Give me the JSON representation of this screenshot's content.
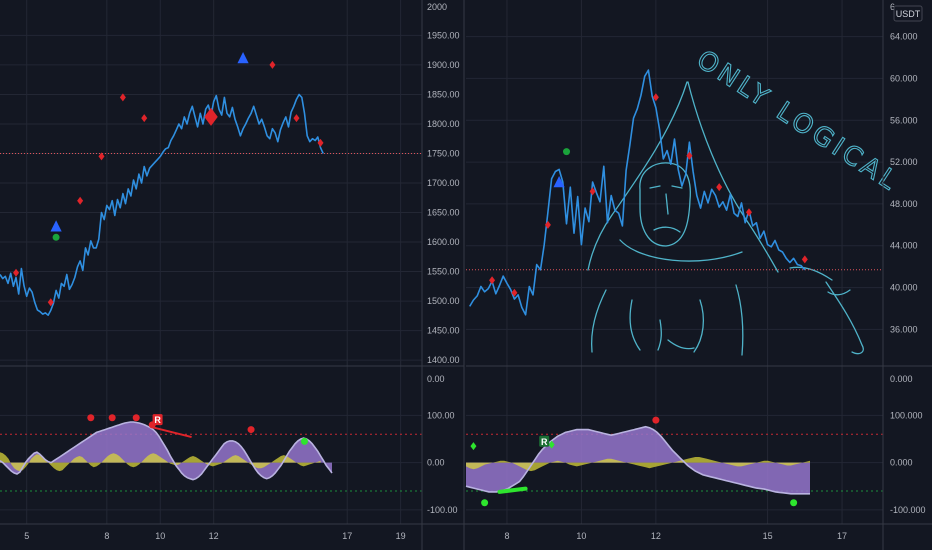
{
  "colors": {
    "background": "#131722",
    "grid": "#232734",
    "divider": "#363a45",
    "price_line": "#2f8fe0",
    "buy_triangle": "#2962ff",
    "sell_diamond": "#e0242a",
    "buy_dot": "#1aa33b",
    "osc_fill": "#9575cd",
    "osc_line": "#b9b3e0",
    "yellow_fill": "#d8d33a",
    "upper_band": "#c62833",
    "lower_band": "#1b8e3c",
    "green_signal": "#2ee52e",
    "doodle": "#4fb3c9",
    "current_price": "#e0535a"
  },
  "left_chart": {
    "chart_data": {
      "type": "line",
      "y_ticks": [
        "1950.00",
        "1900.00",
        "1850.00",
        "1800.00",
        "1750.00",
        "1700.00",
        "1650.00",
        "1600.00",
        "1550.00",
        "1500.00",
        "1450.00",
        "1400.00"
      ],
      "y_tick_values": [
        1950,
        1900,
        1850,
        1800,
        1750,
        1700,
        1650,
        1600,
        1550,
        1500,
        1450,
        1400
      ],
      "y_top_cut_label": "2000",
      "ylim": [
        1390,
        2010
      ],
      "x_ticks": [
        {
          "label": "5",
          "x": 5
        },
        {
          "label": "8",
          "x": 8
        },
        {
          "label": "10",
          "x": 10
        },
        {
          "label": "12",
          "x": 12
        },
        {
          "label": "17",
          "x": 17
        },
        {
          "label": "19",
          "x": 19
        }
      ],
      "xlim": [
        4.0,
        19.8
      ],
      "current_price": 1750,
      "x": [
        4.0,
        4.1,
        4.2,
        4.3,
        4.4,
        4.5,
        4.6,
        4.7,
        4.8,
        4.9,
        5.0,
        5.1,
        5.2,
        5.3,
        5.4,
        5.5,
        5.6,
        5.7,
        5.8,
        5.9,
        6.0,
        6.1,
        6.2,
        6.3,
        6.4,
        6.5,
        6.6,
        6.7,
        6.8,
        6.9,
        7.0,
        7.1,
        7.2,
        7.3,
        7.4,
        7.5,
        7.6,
        7.7,
        7.8,
        7.9,
        8.0,
        8.1,
        8.2,
        8.3,
        8.4,
        8.5,
        8.6,
        8.7,
        8.8,
        8.9,
        9.0,
        9.1,
        9.2,
        9.3,
        9.4,
        9.5,
        9.6,
        9.7,
        9.8,
        9.9,
        10.0,
        10.1,
        10.2,
        10.3,
        10.4,
        10.5,
        10.6,
        10.7,
        10.8,
        10.9,
        11.0,
        11.1,
        11.2,
        11.3,
        11.4,
        11.5,
        11.6,
        11.7,
        11.8,
        11.9,
        12.0,
        12.1,
        12.2,
        12.3,
        12.4,
        12.5,
        12.6,
        12.7,
        12.8,
        12.9,
        13.0,
        13.1,
        13.2,
        13.3,
        13.4,
        13.5,
        13.6,
        13.7,
        13.8,
        13.9,
        14.0,
        14.1,
        14.2,
        14.3,
        14.4,
        14.5,
        14.6,
        14.7,
        14.8,
        14.9,
        15.0,
        15.1,
        15.2,
        15.3,
        15.4,
        15.5,
        15.6,
        15.7,
        15.8,
        15.9,
        16.0,
        16.1
      ],
      "values": [
        1545,
        1538,
        1542,
        1530,
        1547,
        1525,
        1540,
        1512,
        1555,
        1526,
        1508,
        1522,
        1515,
        1498,
        1485,
        1482,
        1478,
        1480,
        1476,
        1484,
        1496,
        1518,
        1505,
        1530,
        1525,
        1545,
        1520,
        1528,
        1540,
        1558,
        1568,
        1552,
        1590,
        1578,
        1602,
        1590,
        1590,
        1605,
        1650,
        1638,
        1662,
        1655,
        1670,
        1645,
        1672,
        1658,
        1682,
        1665,
        1690,
        1678,
        1705,
        1690,
        1715,
        1700,
        1728,
        1712,
        1725,
        1730,
        1735,
        1740,
        1745,
        1752,
        1758,
        1760,
        1772,
        1780,
        1790,
        1800,
        1792,
        1812,
        1800,
        1818,
        1830,
        1812,
        1795,
        1818,
        1800,
        1825,
        1832,
        1815,
        1838,
        1848,
        1825,
        1815,
        1845,
        1818,
        1812,
        1828,
        1808,
        1795,
        1780,
        1792,
        1800,
        1810,
        1818,
        1830,
        1815,
        1800,
        1808,
        1795,
        1780,
        1775,
        1792,
        1785,
        1770,
        1790,
        1802,
        1812,
        1795,
        1820,
        1830,
        1842,
        1850,
        1845,
        1818,
        1780,
        1770,
        1775,
        1772,
        1778,
        1760,
        1750
      ],
      "markers": {
        "buy_triangles": [
          {
            "x": 6.1,
            "y": 1625
          },
          {
            "x": 13.1,
            "y": 1910
          }
        ],
        "buy_dots": [
          {
            "x": 6.1,
            "y": 1608
          }
        ],
        "sell_diamonds": [
          {
            "x": 4.6,
            "y": 1548
          },
          {
            "x": 5.9,
            "y": 1498
          },
          {
            "x": 7.0,
            "y": 1670
          },
          {
            "x": 7.8,
            "y": 1745
          },
          {
            "x": 8.6,
            "y": 1845
          },
          {
            "x": 9.4,
            "y": 1810
          },
          {
            "x": 11.9,
            "y": 1812
          },
          {
            "x": 14.2,
            "y": 1900
          },
          {
            "x": 15.1,
            "y": 1810
          },
          {
            "x": 16.0,
            "y": 1768
          }
        ],
        "big_diamonds": [
          {
            "x": 11.9,
            "y": 1812
          }
        ]
      }
    },
    "osc_data": {
      "type": "area",
      "y_ticks": [
        "100.00",
        "0.00",
        "-100.00"
      ],
      "y_tick_values": [
        100,
        0,
        -100
      ],
      "top_label": "0.00",
      "ylim": [
        -130,
        175
      ],
      "bands": [
        60,
        -60
      ],
      "values": [
        4,
        0,
        -6,
        -12,
        -18,
        -22,
        -24,
        -20,
        -10,
        0,
        8,
        14,
        20,
        22,
        18,
        12,
        6,
        2,
        0,
        4,
        8,
        12,
        16,
        20,
        24,
        28,
        32,
        36,
        40,
        44,
        48,
        52,
        56,
        60,
        64,
        66,
        68,
        70,
        72,
        74,
        76,
        78,
        80,
        82,
        84,
        85,
        86,
        86,
        85,
        84,
        82,
        80,
        77,
        74,
        70,
        64,
        56,
        46,
        36,
        26,
        14,
        4,
        -6,
        -14,
        -22,
        -28,
        -32,
        -34,
        -36,
        -34,
        -30,
        -24,
        -16,
        -8,
        0,
        8,
        16,
        24,
        32,
        40,
        44,
        46,
        46,
        44,
        40,
        34,
        26,
        16,
        6,
        -4,
        -14,
        -22,
        -28,
        -32,
        -34,
        -32,
        -28,
        -22,
        -14,
        -6,
        4,
        14,
        24,
        32,
        40,
        46,
        50,
        52,
        50,
        46,
        40,
        32,
        24,
        14,
        4,
        -6,
        -14,
        -22
      ],
      "yellow": [
        22,
        20,
        15,
        8,
        -4,
        -12,
        -16,
        -18,
        -16,
        -10,
        -2,
        8,
        14,
        18,
        16,
        10,
        4,
        0,
        -6,
        -12,
        -16,
        -18,
        -16,
        -10,
        -4,
        2,
        8,
        12,
        14,
        12,
        6,
        0,
        -6,
        -10,
        -8,
        -4,
        2,
        8,
        14,
        18,
        20,
        18,
        14,
        8,
        2,
        -4,
        -8,
        -10,
        -8,
        -4,
        2,
        8,
        14,
        18,
        20,
        18,
        14,
        10,
        6,
        2,
        -2,
        -4,
        -6,
        -4,
        0,
        4,
        8,
        12,
        14,
        12,
        8,
        4,
        0,
        -4,
        -6,
        -8,
        -6,
        -4,
        -2,
        2,
        6,
        10,
        14,
        16,
        14,
        10,
        6,
        2,
        -2,
        -6,
        -10,
        -12,
        -12,
        -10,
        -6,
        -2,
        2,
        6,
        10,
        14,
        16,
        14,
        10,
        6,
        2,
        -2,
        -6,
        -8,
        -6,
        -4,
        -2,
        0,
        2,
        4
      ],
      "signals": {
        "red_dots": [
          {
            "x": 7.4,
            "y": 95
          },
          {
            "x": 8.2,
            "y": 95
          },
          {
            "x": 9.1,
            "y": 95
          },
          {
            "x": 9.7,
            "y": 80
          },
          {
            "x": 13.4,
            "y": 70
          }
        ],
        "green_dots": [
          {
            "x": 15.4,
            "y": 45
          }
        ],
        "r_label": {
          "x": 9.9,
          "y": 88,
          "text": "R"
        }
      }
    }
  },
  "right_chart": {
    "unit_badge": "USDT",
    "chart_data": {
      "type": "line",
      "y_ticks": [
        "64.000",
        "60.000",
        "56.000",
        "52.000",
        "48.000",
        "44.000",
        "40.000",
        "36.000"
      ],
      "y_tick_values": [
        64,
        60,
        56,
        52,
        48,
        44,
        40,
        36
      ],
      "y_top_cut_label": "6",
      "ylim": [
        32.5,
        67.5
      ],
      "x_ticks": [
        {
          "label": "8",
          "x": 8
        },
        {
          "label": "10",
          "x": 10
        },
        {
          "label": "12",
          "x": 12
        },
        {
          "label": "15",
          "x": 15
        },
        {
          "label": "17",
          "x": 17
        }
      ],
      "xlim": [
        6.9,
        18.1
      ],
      "current_price": 41.7,
      "x": [
        7.0,
        7.1,
        7.2,
        7.3,
        7.4,
        7.5,
        7.6,
        7.7,
        7.8,
        7.9,
        8.0,
        8.1,
        8.2,
        8.3,
        8.4,
        8.5,
        8.6,
        8.7,
        8.8,
        8.9,
        9.0,
        9.1,
        9.2,
        9.3,
        9.4,
        9.5,
        9.6,
        9.7,
        9.8,
        9.9,
        10.0,
        10.1,
        10.2,
        10.3,
        10.4,
        10.5,
        10.6,
        10.7,
        10.8,
        10.9,
        11.0,
        11.1,
        11.2,
        11.3,
        11.4,
        11.5,
        11.6,
        11.7,
        11.8,
        11.9,
        12.0,
        12.1,
        12.2,
        12.3,
        12.4,
        12.5,
        12.6,
        12.7,
        12.8,
        12.9,
        13.0,
        13.1,
        13.2,
        13.3,
        13.4,
        13.5,
        13.6,
        13.7,
        13.8,
        13.9,
        14.0,
        14.1,
        14.2,
        14.3,
        14.4,
        14.5,
        14.6,
        14.7,
        14.8,
        14.9,
        15.0,
        15.1,
        15.2,
        15.3,
        15.4,
        15.5,
        15.6,
        15.7,
        15.8,
        15.9,
        16.0
      ],
      "values": [
        38.2,
        38.8,
        39.2,
        40.1,
        39.6,
        39.9,
        40.6,
        39.4,
        40.2,
        41.1,
        40.4,
        39.8,
        38.9,
        39.3,
        38.1,
        37.4,
        40.1,
        39.3,
        42.2,
        41.7,
        44.1,
        47.2,
        50.4,
        51.1,
        51.3,
        50.1,
        46.1,
        49.6,
        45.2,
        48.7,
        44.1,
        47.6,
        46.3,
        50.1,
        49.1,
        48.2,
        51.6,
        46.2,
        48.8,
        47.4,
        47.1,
        45.9,
        51.2,
        53.6,
        56.2,
        57.1,
        58.4,
        60.2,
        60.8,
        58.3,
        57.2,
        55.1,
        52.3,
        53.1,
        51.8,
        54.2,
        51.3,
        49.7,
        50.8,
        53.9,
        51.1,
        48.8,
        47.6,
        49.2,
        48.1,
        49.4,
        48.8,
        47.7,
        48.2,
        47.4,
        48.9,
        47.1,
        46.8,
        48.1,
        46.2,
        47.4,
        45.9,
        46.2,
        44.7,
        45.4,
        44.1,
        43.9,
        44.5,
        43.6,
        43.4,
        42.8,
        42.4,
        42.8,
        42.2,
        42.1,
        41.7
      ],
      "markers": {
        "buy_triangles": [
          {
            "x": 9.4,
            "y": 50.0
          }
        ],
        "buy_dots": [
          {
            "x": 9.6,
            "y": 53.0
          }
        ],
        "sell_diamonds": [
          {
            "x": 7.6,
            "y": 40.7
          },
          {
            "x": 8.2,
            "y": 39.5
          },
          {
            "x": 9.1,
            "y": 46.0
          },
          {
            "x": 10.3,
            "y": 49.2
          },
          {
            "x": 12.0,
            "y": 58.2
          },
          {
            "x": 12.9,
            "y": 52.6
          },
          {
            "x": 13.7,
            "y": 49.6
          },
          {
            "x": 14.5,
            "y": 47.2
          },
          {
            "x": 16.0,
            "y": 42.7
          }
        ]
      }
    },
    "osc_data": {
      "type": "area",
      "y_ticks": [
        "100.000",
        "0.000",
        "-100.000"
      ],
      "y_tick_values": [
        100,
        0,
        -100
      ],
      "top_label": "0.000",
      "ylim": [
        -130,
        175
      ],
      "bands": [
        60,
        -60
      ],
      "values": [
        -50,
        -52,
        -54,
        -56,
        -58,
        -60,
        -62,
        -62,
        -62,
        -60,
        -58,
        -55,
        -50,
        -45,
        -40,
        -30,
        -18,
        -6,
        6,
        18,
        28,
        36,
        44,
        50,
        56,
        60,
        64,
        66,
        68,
        70,
        70,
        70,
        70,
        68,
        66,
        64,
        62,
        60,
        58,
        60,
        62,
        64,
        66,
        68,
        70,
        72,
        74,
        76,
        74,
        70,
        64,
        56,
        46,
        36,
        26,
        18,
        10,
        2,
        -6,
        -12,
        -18,
        -22,
        -26,
        -28,
        -30,
        -32,
        -34,
        -36,
        -38,
        -40,
        -42,
        -44,
        -46,
        -48,
        -50,
        -52,
        -54,
        -55,
        -56,
        -58,
        -60,
        -62,
        -63,
        -64,
        -65,
        -66,
        -66,
        -66,
        -66,
        -66,
        -66
      ],
      "yellow": [
        -8,
        -12,
        -14,
        -12,
        -8,
        -4,
        -2,
        0,
        2,
        4,
        4,
        2,
        0,
        -4,
        -8,
        -12,
        -16,
        -18,
        -16,
        -12,
        -8,
        -4,
        0,
        2,
        4,
        2,
        0,
        -4,
        -6,
        -8,
        -6,
        -4,
        -2,
        0,
        2,
        4,
        6,
        8,
        8,
        6,
        4,
        2,
        0,
        -2,
        -4,
        -6,
        -8,
        -10,
        -12,
        -10,
        -8,
        -6,
        -4,
        -2,
        0,
        2,
        4,
        6,
        8,
        10,
        12,
        12,
        10,
        8,
        6,
        4,
        2,
        0,
        -2,
        -4,
        -6,
        -8,
        -8,
        -6,
        -4,
        -2,
        0,
        2,
        4,
        4,
        2,
        0,
        -2,
        -4,
        -6,
        -6,
        -4,
        -2,
        0,
        2,
        4
      ],
      "signals": {
        "red_dots": [
          {
            "x": 12.0,
            "y": 90
          }
        ],
        "green_diamonds": [
          {
            "x": 7.1,
            "y": 35
          },
          {
            "x": 9.2,
            "y": 38
          }
        ],
        "green_dots": [
          {
            "x": 7.4,
            "y": -85
          },
          {
            "x": 15.7,
            "y": -85
          }
        ],
        "r_label": {
          "x": 9.0,
          "y": 42,
          "text": "R"
        },
        "green_segment": [
          {
            "x": 7.8,
            "y": -62
          },
          {
            "x": 8.5,
            "y": -55
          }
        ]
      }
    },
    "doodle_text": "ONLY LOGICAL"
  }
}
